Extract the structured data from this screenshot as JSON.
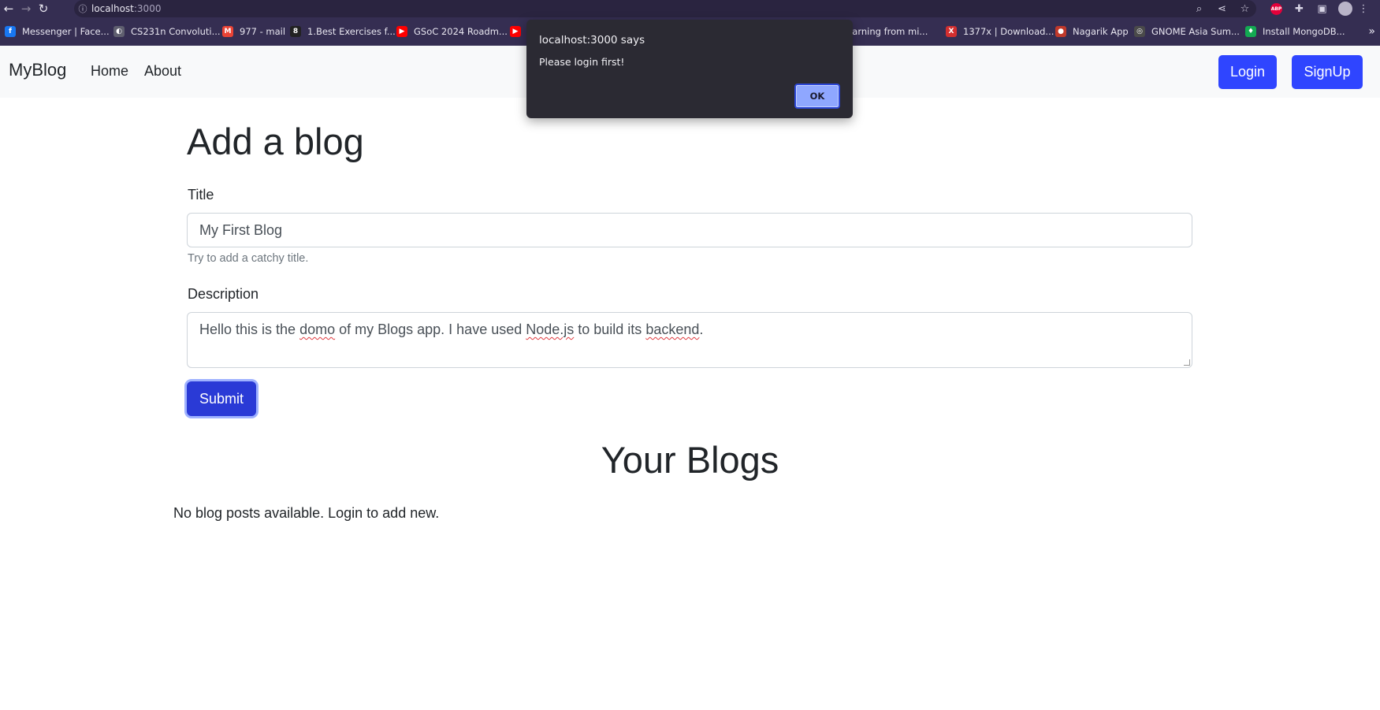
{
  "browser": {
    "url_host": "localhost",
    "url_port": ":3000",
    "bookmarks": [
      {
        "label": "Messenger | Face...",
        "color": "#1877f2",
        "glyph": "f"
      },
      {
        "label": "CS231n Convoluti...",
        "color": "#5f5f6f",
        "glyph": "◐"
      },
      {
        "label": "977 - mail",
        "color": "#ea4335",
        "glyph": "M"
      },
      {
        "label": "1.Best Exercises f...",
        "color": "#222222",
        "glyph": "8"
      },
      {
        "label": "GSoC 2024 Roadm...",
        "color": "#ff0000",
        "glyph": "▶"
      },
      {
        "label": "",
        "color": "#ff0000",
        "glyph": "▶"
      },
      {
        "label": "Learning from mi...",
        "color": "#352e52",
        "glyph": ""
      },
      {
        "label": "1377x | Download...",
        "color": "#d32f2f",
        "glyph": "X"
      },
      {
        "label": "Nagarik App",
        "color": "#c0392b",
        "glyph": "●"
      },
      {
        "label": "GNOME Asia Sum...",
        "color": "#4a4a4a",
        "glyph": "◎"
      },
      {
        "label": "Install MongoDB...",
        "color": "#13aa52",
        "glyph": "♦"
      }
    ]
  },
  "navbar": {
    "brand": "MyBlog",
    "links": [
      "Home",
      "About"
    ],
    "login": "Login",
    "signup": "SignUp"
  },
  "form": {
    "heading": "Add a blog",
    "title_label": "Title",
    "title_value": "My First Blog",
    "title_help": "Try to add a catchy title.",
    "desc_label": "Description",
    "desc_parts": [
      "Hello this is the ",
      "domo",
      " of my Blogs app.  I have used ",
      "Node.js",
      " to build its ",
      "backend",
      "."
    ],
    "submit": "Submit"
  },
  "blogs": {
    "title": "Your Blogs",
    "empty": "No blog posts available. Login to add new."
  },
  "dialog": {
    "title": "localhost:3000 says",
    "message": "Please login first!",
    "ok": "OK"
  }
}
